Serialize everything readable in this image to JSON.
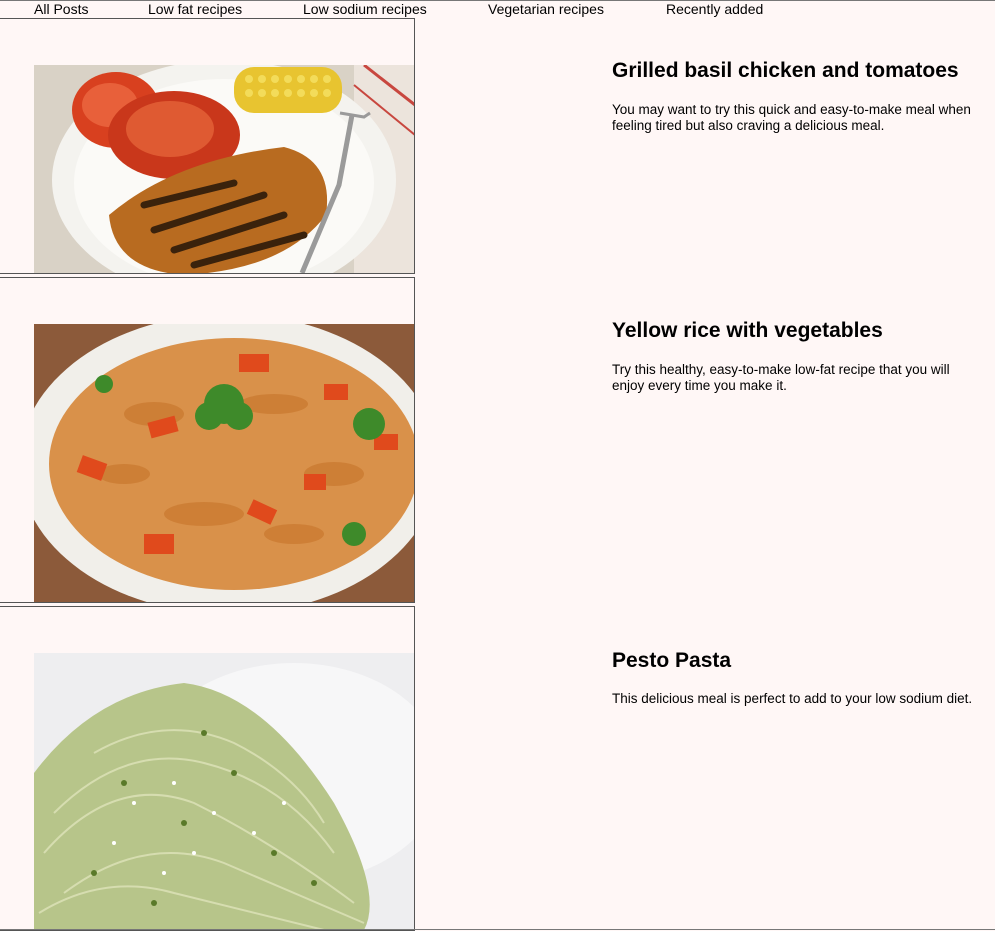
{
  "nav": {
    "items": [
      "All Posts",
      "Low fat recipes",
      "Low sodium recipes",
      "Vegetarian recipes",
      "Recently added"
    ]
  },
  "posts": [
    {
      "title": "Grilled basil chicken and tomatoes",
      "description": "You may want to try this quick and easy-to-make meal when feeling tired but also craving a delicious meal.",
      "image": "grilled-chicken-photo"
    },
    {
      "title": "Yellow rice with vegetables",
      "description": "Try this healthy, easy-to-make low-fat recipe that you will enjoy every time you make it.",
      "image": "yellow-rice-photo"
    },
    {
      "title": "Pesto Pasta",
      "description": "This delicious meal is perfect to add to your low sodium diet.",
      "image": "pesto-pasta-photo"
    }
  ]
}
